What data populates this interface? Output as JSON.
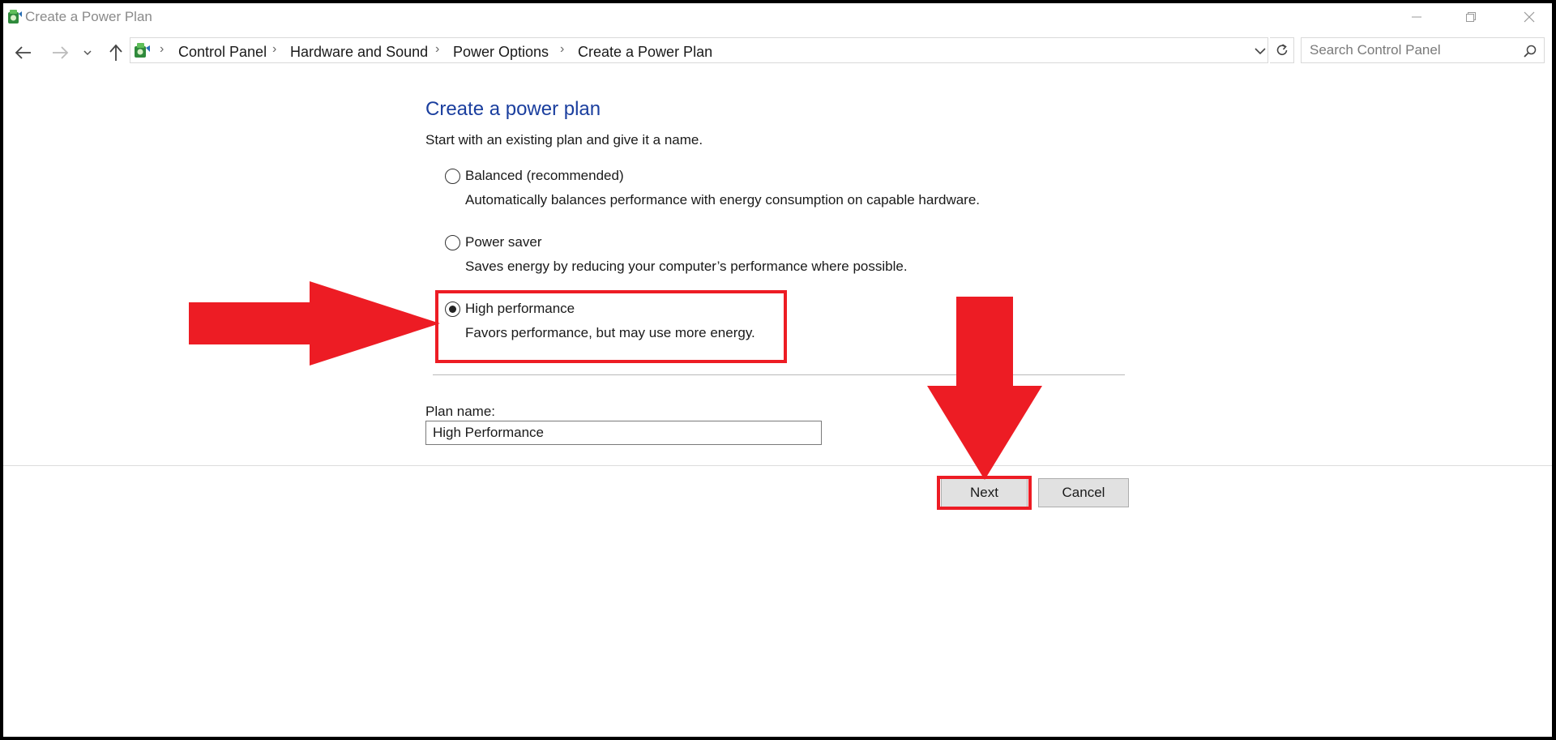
{
  "window": {
    "title": "Create a Power Plan",
    "icons": {
      "app": "power-plan-icon",
      "minimize": "minimize-icon",
      "restore": "restore-icon",
      "close": "close-icon"
    }
  },
  "nav": {
    "icons": [
      "back-arrow-icon",
      "forward-arrow-icon",
      "recent-locations-chevron-icon",
      "up-arrow-icon"
    ]
  },
  "breadcrumb": {
    "items": [
      "Control Panel",
      "Hardware and Sound",
      "Power Options",
      "Create a Power Plan"
    ]
  },
  "search": {
    "placeholder": "Search Control Panel",
    "value": ""
  },
  "content": {
    "heading": "Create a power plan",
    "intro": "Start with an existing plan and give it a name.",
    "options": [
      {
        "label": "Balanced (recommended)",
        "description": "Automatically balances performance with energy consumption on capable hardware.",
        "selected": false
      },
      {
        "label": "Power saver",
        "description": "Saves energy by reducing your computer’s performance where possible.",
        "selected": false
      },
      {
        "label": "High performance",
        "description": "Favors performance, but may use more energy.",
        "selected": true
      }
    ],
    "plan_name_label": "Plan name:",
    "plan_name_value": "High Performance"
  },
  "buttons": {
    "next": "Next",
    "cancel": "Cancel"
  },
  "annotations": {
    "color": "#ed1c24",
    "highlighted": [
      "High performance option",
      "Next button"
    ]
  },
  "colors": {
    "heading": "#1a3e9e",
    "annotation_red": "#ed1c24"
  }
}
